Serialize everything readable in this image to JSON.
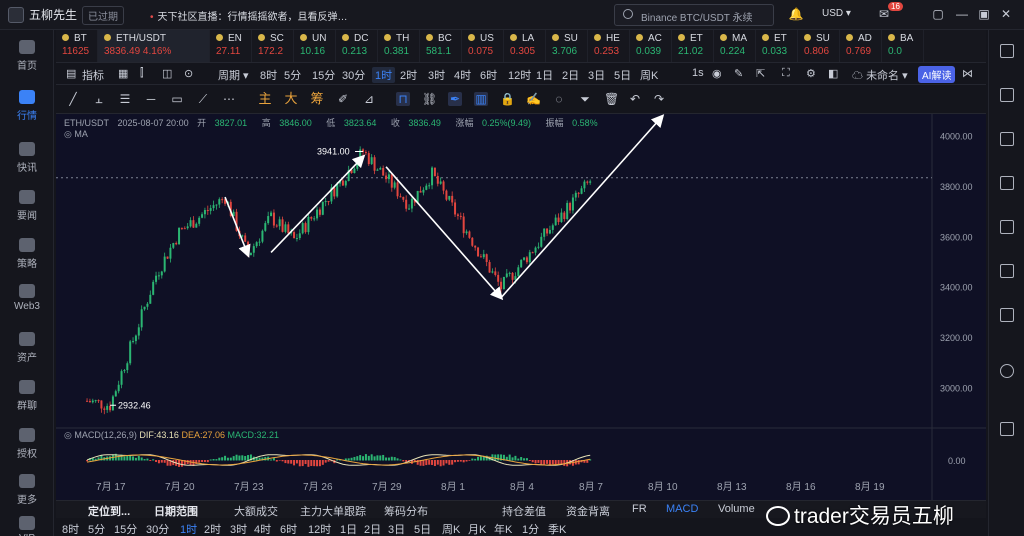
{
  "app": {
    "name": "五柳先生",
    "expired": "已过期",
    "news": "天下社区直播：行情摇摇欲者，且看反弹…",
    "search_placeholder": "Binance BTC/USDT 永续",
    "currency": "USD",
    "notification_count": "16"
  },
  "sidebar": [
    {
      "label": "首页",
      "icon": "home-icon"
    },
    {
      "label": "行情",
      "icon": "chart-bars-icon",
      "active": true
    },
    {
      "label": "快讯",
      "icon": "flash-news-icon"
    },
    {
      "label": "要闻",
      "icon": "newspaper-icon"
    },
    {
      "label": "策略",
      "icon": "robot-icon"
    },
    {
      "label": "Web3",
      "icon": "web3-icon"
    },
    {
      "label": "资产",
      "icon": "wallet-icon"
    },
    {
      "label": "群聊",
      "icon": "chat-icon"
    },
    {
      "label": "授权",
      "icon": "key-icon"
    },
    {
      "label": "更多",
      "icon": "more-icon"
    },
    {
      "label": "VIP",
      "icon": "vip-icon"
    }
  ],
  "tickers": [
    {
      "sym": "BT",
      "px": "11625",
      "dir": "down"
    },
    {
      "sym": "ETH/USDT",
      "px": "3836.49  4.16%",
      "dir": "down",
      "active": true
    },
    {
      "sym": "EN",
      "px": "27.11",
      "dir": "down"
    },
    {
      "sym": "SC",
      "px": "172.2",
      "dir": "down"
    },
    {
      "sym": "UN",
      "px": "10.16",
      "dir": "up"
    },
    {
      "sym": "DC",
      "px": "0.213",
      "dir": "up"
    },
    {
      "sym": "TH",
      "px": "0.381",
      "dir": "up"
    },
    {
      "sym": "BC",
      "px": "581.1",
      "dir": "up"
    },
    {
      "sym": "US",
      "px": "0.075",
      "dir": "down"
    },
    {
      "sym": "LA",
      "px": "0.305",
      "dir": "down"
    },
    {
      "sym": "SU",
      "px": "3.706",
      "dir": "up"
    },
    {
      "sym": "HE",
      "px": "0.253",
      "dir": "down"
    },
    {
      "sym": "AC",
      "px": "0.039",
      "dir": "up"
    },
    {
      "sym": "ET",
      "px": "21.02",
      "dir": "up"
    },
    {
      "sym": "MA",
      "px": "0.224",
      "dir": "up"
    },
    {
      "sym": "ET",
      "px": "0.033",
      "dir": "up"
    },
    {
      "sym": "SU",
      "px": "0.806",
      "dir": "down"
    },
    {
      "sym": "AD",
      "px": "0.769",
      "dir": "down"
    },
    {
      "sym": "BA",
      "px": "0.0",
      "dir": "up"
    }
  ],
  "toolbar": {
    "indicator": "指标",
    "period": "周期",
    "timeframes": [
      "8时",
      "5分",
      "15分",
      "30分",
      "1时",
      "2时",
      "3时",
      "4时",
      "6时",
      "12时",
      "1日",
      "2日",
      "3日",
      "5日",
      "周K"
    ],
    "active_tf": "1时",
    "seconds": "1s",
    "layout_name": "未命名",
    "ai_button": "AI解读"
  },
  "drawbar": {
    "zh_tools": [
      "主",
      "大",
      "筹"
    ]
  },
  "chart": {
    "pair": "ETH/USDT",
    "datetime": "2025-08-07 20:00",
    "open_label": "开",
    "open": "3827.01",
    "high_label": "高",
    "high": "3846.00",
    "low_label": "低",
    "low": "3823.64",
    "close_label": "收",
    "close": "3836.49",
    "change_label": "涨幅",
    "change": "0.25%(9.49)",
    "amp_label": "振幅",
    "amp": "0.58%",
    "ma_label": "MA",
    "annotation_high": "3941.00",
    "annotation_low": "2932.46",
    "macd_label": "MACD(12,26,9)",
    "dif": "DIF:43.16",
    "dea": "DEA:27.06",
    "macd": "MACD:32.21",
    "macd_axis": "0.00",
    "price_ticks": [
      "4000.00",
      "3800.00",
      "3600.00",
      "3400.00",
      "3200.00",
      "3000.00"
    ],
    "date_ticks": [
      "7月 17",
      "7月 20",
      "7月 23",
      "7月 26",
      "7月 29",
      "8月 1",
      "8月 4",
      "8月 7",
      "8月 10",
      "8月 13",
      "8月 16",
      "8月 19"
    ],
    "colors": {
      "up": "#2bb673",
      "down": "#e2463f",
      "dif": "#e8e2b6",
      "dea": "#e8a23c",
      "bg": "#0f1025",
      "accent": "#3b82f6"
    }
  },
  "bottom_tabs": [
    "定位到...",
    "日期范围",
    "大额成交",
    "主力大单跟踪",
    "筹码分布",
    "持仓差值",
    "资金背离",
    "FR",
    "MACD",
    "Volume"
  ],
  "bottom_timeframes": [
    "8时",
    "5分",
    "15分",
    "30分",
    "1时",
    "2时",
    "3时",
    "4时",
    "6时",
    "12时",
    "1日",
    "2日",
    "3日",
    "5日",
    "周K",
    "月K",
    "年K",
    "1分",
    "季K"
  ],
  "watermark": "trader交易员五柳",
  "chart_data": {
    "type": "candlestick",
    "title": "ETH/USDT",
    "interval": "1h",
    "ylim": [
      2850,
      4090
    ],
    "key_points": [
      {
        "date": "7月 16",
        "price": 2950
      },
      {
        "date": "7月 17",
        "price": 2932.46
      },
      {
        "date": "7月 19",
        "price": 3450
      },
      {
        "date": "7月 20",
        "price": 3620
      },
      {
        "date": "7月 22",
        "price": 3760
      },
      {
        "date": "7月 23",
        "price": 3530
      },
      {
        "date": "7月 24",
        "price": 3680
      },
      {
        "date": "7月 25",
        "price": 3590
      },
      {
        "date": "7月 27",
        "price": 3820
      },
      {
        "date": "7月 28",
        "price": 3941.0
      },
      {
        "date": "7月 30",
        "price": 3730
      },
      {
        "date": "7月 31",
        "price": 3850
      },
      {
        "date": "8月 3",
        "price": 3400
      },
      {
        "date": "8月 5",
        "price": 3620
      },
      {
        "date": "8月 7",
        "price": 3836.49
      }
    ]
  }
}
